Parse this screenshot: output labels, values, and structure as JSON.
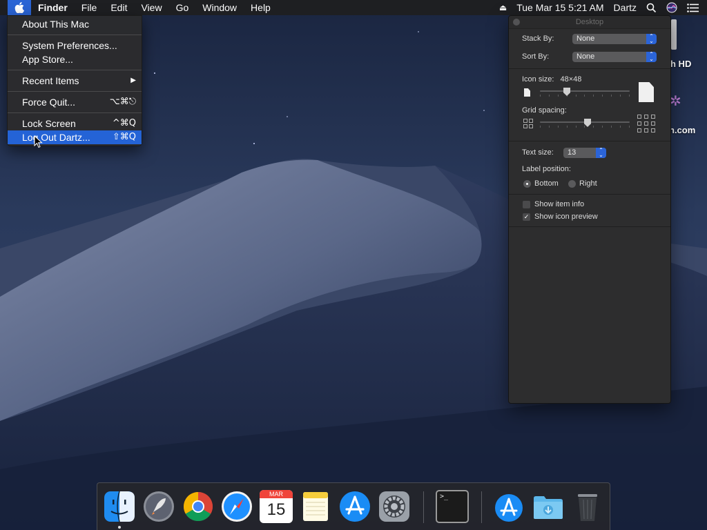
{
  "menubar": {
    "app_name": "Finder",
    "items": [
      "File",
      "Edit",
      "View",
      "Go",
      "Window",
      "Help"
    ],
    "clock": "Tue Mar 15  5:21 AM",
    "user": "Dartz",
    "icons": [
      "eject-icon",
      "spotlight-search-icon",
      "siri-icon",
      "notification-center-icon"
    ]
  },
  "apple_menu": {
    "about": "About This Mac",
    "system_prefs": "System Preferences...",
    "app_store": "App Store...",
    "recent_items": "Recent Items",
    "force_quit": "Force Quit...",
    "force_quit_shortcut": "⌥⌘⎋",
    "lock_screen": "Lock Screen",
    "lock_screen_shortcut": "^⌘Q",
    "log_out": "Log Out Dartz...",
    "log_out_shortcut": "⇧⌘Q"
  },
  "panel": {
    "title": "Desktop",
    "stack_by_label": "Stack By:",
    "stack_by_value": "None",
    "sort_by_label": "Sort By:",
    "sort_by_value": "None",
    "icon_size_label": "Icon size:",
    "icon_size_value": "48×48",
    "grid_spacing_label": "Grid spacing:",
    "text_size_label": "Text size:",
    "text_size_value": "13",
    "label_position_label": "Label position:",
    "label_bottom": "Bottom",
    "label_right": "Right",
    "show_item_info": "Show item info",
    "show_icon_preview": "Show icon preview",
    "label_position_selected": "Bottom",
    "show_item_info_checked": false,
    "show_icon_preview_checked": true
  },
  "desktop": {
    "drive_label_1": "h HD",
    "drive_label_2": "n.com"
  },
  "dock": {
    "apps": [
      "Finder",
      "Launchpad",
      "Google Chrome",
      "Safari",
      "Calendar",
      "Notes",
      "App Store",
      "System Preferences",
      "Terminal",
      "Downloads Stack",
      "Downloads",
      "Trash"
    ],
    "calendar_month": "MAR",
    "calendar_day": "15",
    "terminal_prompt": ">_"
  },
  "colors": {
    "selection": "#2463d6",
    "menubar": "#1e1e20",
    "panel_bg": "#2d2d2e"
  }
}
